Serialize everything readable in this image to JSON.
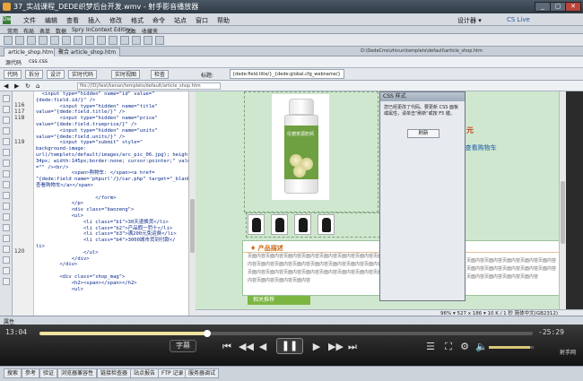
{
  "window": {
    "title": "37_实战课程_DEDE织梦后台开发.wmv - 射手影音播放器",
    "menu": [
      "文件",
      "编辑",
      "查看",
      "插入",
      "修改",
      "格式",
      "命令",
      "站点",
      "窗口",
      "帮助"
    ],
    "right_label": "设计器 ▾",
    "cs_live": "CS Live"
  },
  "insert_bar": [
    "常用",
    "布局",
    "表单",
    "数据",
    "Spry",
    "InContext Editing",
    "文本",
    "收藏夹"
  ],
  "doc_tabs": [
    "article_shop.htm",
    "聚合 article_shop.htm"
  ],
  "doc_path": "D:\\DedeCms\\zhicun\\templets\\default\\article_shop.htm",
  "related_files": [
    "源代码",
    "css.css"
  ],
  "view_buttons": [
    "代码",
    "拆分",
    "设计",
    "实时代码",
    "实时视图",
    "检查"
  ],
  "title_label": "标题:",
  "title_value": "{dede:field.title/}_{dede:global.cfg_webname/}",
  "address": "file:///D|/test/kenan/templets/default/article_shop.htm",
  "line_numbers": [
    "116",
    "117",
    "118",
    "",
    "",
    "",
    "119",
    "",
    "",
    "",
    "",
    "",
    "",
    "",
    "",
    "",
    "",
    "",
    "",
    "",
    "",
    "",
    "",
    "",
    "120"
  ],
  "code_lines": [
    "  <input type=\"hidden\" name=\"id\" value=\"",
    "{dede:field.id/}\" />",
    "        <input type=\"hidden\" name=\"title\"",
    "value=\"{dede:field.title/}\" />",
    "        <input type=\"hidden\" name=\"price\"",
    "value=\"{dede:field.trueprice/}\" />",
    "        <input type=\"hidden\" name=\"units\"",
    "value=\"{dede:field.units/}\" />",
    "        <input type=\"submit\" style=\"",
    "background-image:",
    "url(/templets/default/images/arc_pic_06.jpg); height:",
    "34px; width:145px;border:none; cursor:pointer;\" value",
    "=\"\" /><br/>",
    "            <span>购物车: </span><a href=",
    "\"{dede:field name='phpurl'/}/car.php\" target=\"_blank\"",
    "查看购物车</a></span>",
    "",
    "                    </form>",
    "            </p>",
    "            <div class=\"baozeng\">",
    "            <ul>",
    "                <li class=\"b1\">30天退换货</li>",
    "                <li class=\"b2\">产品假一罚十</li>",
    "                <li class=\"b3\">满200元免运费</li>",
    "                <li class=\"b4\">3000城市货到付款</",
    "li>",
    "                </ul>",
    "            </div>",
    "        </div>",
    "",
    "        <div class=\"shop_mag\">",
    "            <h2><span></span></h2>",
    "            <ul>"
  ],
  "product": {
    "bottle_label": "伦德茶源奶钙",
    "price": "元",
    "cart_text": "购物车: 查看购物车",
    "section_title": "♦ 产品描述",
    "desc_text": "页面内容页面内容页面内容页面内容页面内容页面内容页面内容页面内容页面内容页面内容页面内容页面内容页面内容页面内容页面内容页面内容页面内容页面内容页面内容页面内容页面内容页面内容页面内容页面内容页面内容页面内容",
    "desc_text_right": "页面内容页面内容页面内容页面内容页面内容页面内容页面内容页面内容页面内容页面内容页面内容页面内容页面内容页面内容",
    "green_bar": "相关推荐"
  },
  "css_dialog": {
    "title": "CSS 样式",
    "message": "您已经更改了代码。要更新 CSS 面板或属性，请单击\"刷新\"或按 F5 键。",
    "button": "刷新"
  },
  "status": "96% ▾ 527 x 186 ▾ 10 K / 1 秒 简体中文(GB2312)",
  "properties_label": "属性",
  "player": {
    "elapsed": "13:04",
    "remaining": "-25:29",
    "progress": 0.34,
    "volume": 0.92,
    "subtitle_button": "字幕",
    "play_glyph": "❚❚",
    "brand": "射手网"
  },
  "bottom_tabs": [
    "搜索",
    "参考",
    "验证",
    "浏览器兼容性",
    "链接检查器",
    "站点报告",
    "FTP 记录",
    "服务器调试"
  ]
}
